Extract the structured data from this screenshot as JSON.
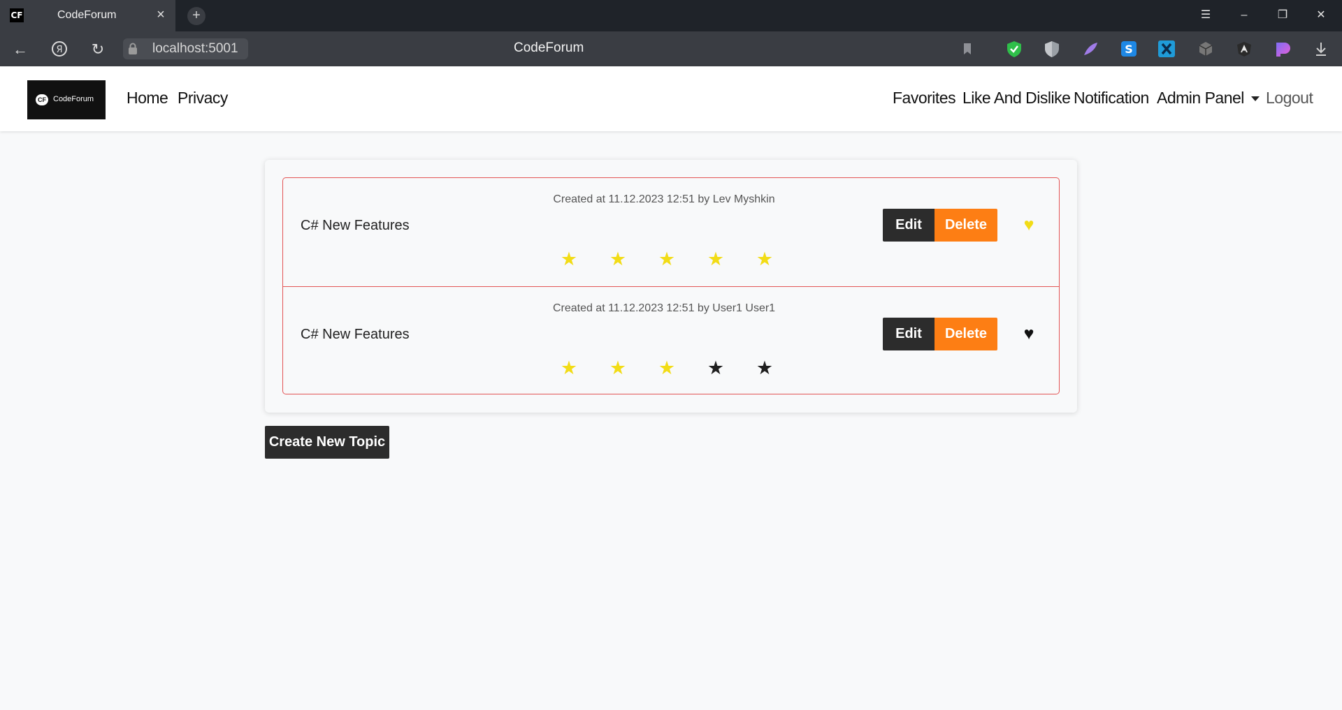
{
  "browser": {
    "tab_favicon": "CF",
    "tab_title": "CodeForum",
    "tab_close": "×",
    "new_tab": "+",
    "url": "localhost:5001",
    "page_title": "CodeForum",
    "icons": [
      "back-icon",
      "yandex-icon",
      "reload-icon",
      "lock-icon",
      "bookmark-icon",
      "menu-icon",
      "minimize-icon",
      "restore-icon",
      "close-icon",
      "download-icon"
    ],
    "extensions": [
      {
        "name": "shield-check-extension",
        "color": "#2fbf4a"
      },
      {
        "name": "shield-grey-extension",
        "color": "#9aa0a6"
      },
      {
        "name": "feather-extension",
        "color": "#a07ce8"
      },
      {
        "name": "s-extension",
        "color": "#1e88e5"
      },
      {
        "name": "x-extension",
        "color": "#1f9bd8"
      },
      {
        "name": "cube-extension",
        "color": "#777777"
      },
      {
        "name": "angular-extension",
        "color": "#222222"
      },
      {
        "name": "gradient-extension",
        "color": "#c165f0"
      }
    ]
  },
  "navbar": {
    "brand_badge": "CF",
    "brand_text": "CodeForum",
    "left_links": [
      "Home",
      "Privacy"
    ],
    "right_links": [
      "Favorites",
      "Like And Dislike",
      "Notification",
      "Admin Panel",
      "Logout"
    ]
  },
  "topics": [
    {
      "title": "C# New Features",
      "meta": "Created at 11.12.2023 12:51 by Lev Myshkin",
      "rating": 5,
      "favorite": true,
      "edit_label": "Edit",
      "delete_label": "Delete"
    },
    {
      "title": "C# New Features",
      "meta": "Created at 11.12.2023 12:51 by User1 User1",
      "rating": 3,
      "favorite": false,
      "edit_label": "Edit",
      "delete_label": "Delete"
    }
  ],
  "create_button": "Create New Topic",
  "colors": {
    "accent_orange": "#fd7e14",
    "star_filled": "#f2dc16",
    "star_empty": "#1f1f1f",
    "border_red": "#e35454",
    "dark_button": "#2c2c2c"
  }
}
